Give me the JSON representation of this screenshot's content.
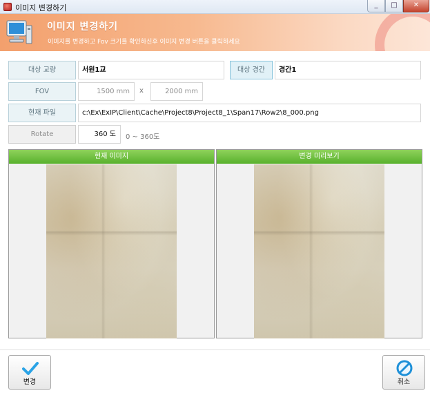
{
  "window": {
    "title": "이미지 변경하기"
  },
  "header": {
    "title": "이미지 변경하기",
    "subtitle": "이미지를 변경하고 Fov 크기를 확인하신후 이미지 변경 버튼을 클릭하세요"
  },
  "form": {
    "bridge_label": "대상 교량",
    "bridge_value": "서원1교",
    "span_label": "대상 경간",
    "span_value": "경간1",
    "fov_label": "FOV",
    "fov_width": "1500",
    "fov_height": "2000",
    "fov_unit": "mm",
    "fov_separator": "x",
    "file_label": "현재 파일",
    "file_path": "c:\\Ex\\ExIP\\Client\\Cache\\Project8\\Project8_1\\Span17\\Row2\\8_000.png",
    "rotate_label": "Rotate",
    "rotate_value": "360",
    "rotate_unit": "도",
    "rotate_range": "0 ~ 360도"
  },
  "panels": {
    "current_title": "현재 이미지",
    "preview_title": "변경 미리보기"
  },
  "buttons": {
    "change_label": "변경",
    "cancel_label": "취소"
  },
  "colors": {
    "header_accent": "#f3a06d",
    "panel_header": "#6cc13a",
    "change_icon": "#2aa3e6",
    "cancel_icon": "#1e90d8"
  }
}
